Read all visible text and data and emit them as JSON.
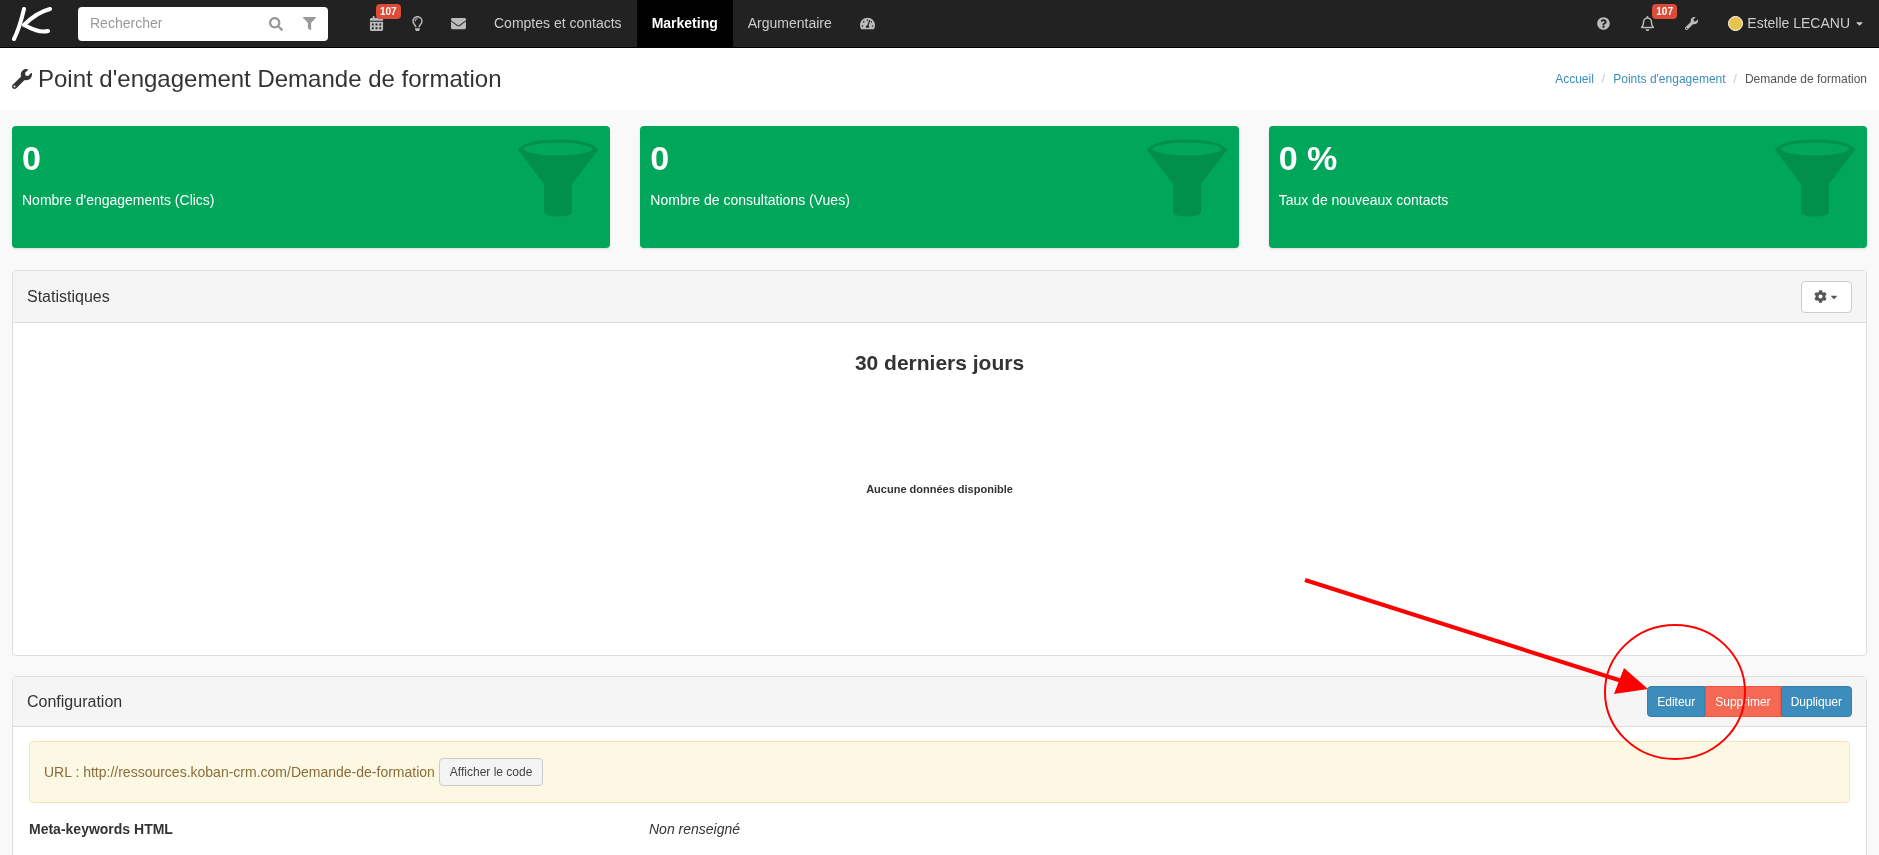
{
  "navbar": {
    "search": {
      "placeholder": "Rechercher"
    },
    "items": [
      {
        "kind": "icon",
        "badge": "107",
        "selected": false
      },
      {
        "kind": "icon",
        "selected": false
      },
      {
        "kind": "icon",
        "selected": false
      },
      {
        "kind": "text",
        "label": "Comptes et contacts",
        "selected": false
      },
      {
        "kind": "text",
        "label": "Marketing",
        "selected": true
      },
      {
        "kind": "text",
        "label": "Argumentaire",
        "selected": false
      },
      {
        "kind": "icon",
        "selected": false
      }
    ],
    "right": {
      "notifications_badge": "107",
      "user": "Estelle LECANU"
    }
  },
  "page": {
    "title": "Point d'engagement Demande de formation",
    "breadcrumb_separator": "/",
    "breadcrumb": [
      {
        "label": "Accueil",
        "link": true
      },
      {
        "label": "Points d'engagement",
        "link": true
      },
      {
        "label": "Demande de formation",
        "link": false
      }
    ]
  },
  "stat_cards": [
    {
      "value": "0",
      "label": "Nombre d'engagements (Clics)"
    },
    {
      "value": "0",
      "label": "Nombre de consultations (Vues)"
    },
    {
      "value": "0 %",
      "label": "Taux de nouveaux contacts"
    }
  ],
  "statistics": {
    "title": "Statistiques",
    "chart_title": "30 derniers jours",
    "empty_message": "Aucune données disponible"
  },
  "configuration": {
    "title": "Configuration",
    "actions": [
      {
        "label": "Editeur",
        "kind": "primary"
      },
      {
        "label": "Supprimer",
        "kind": "danger"
      },
      {
        "label": "Dupliquer",
        "kind": "primary"
      }
    ],
    "url_text": "URL : http://ressources.koban-crm.com/Demande-de-formation",
    "show_code_button": "Afficher le code",
    "fields": [
      {
        "label": "Meta-keywords HTML",
        "value": "Non renseigné"
      }
    ]
  }
}
